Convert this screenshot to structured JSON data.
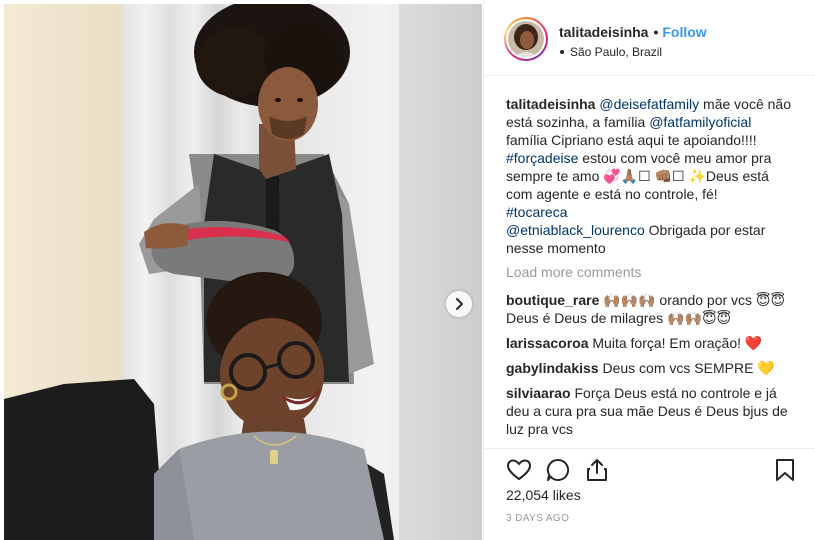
{
  "post": {
    "owner": {
      "username": "talitadeisinha",
      "separator": "•",
      "follow_label": "Follow",
      "location": "São Paulo, Brazil"
    },
    "carousel": {
      "next_icon": "chevron-right-icon"
    },
    "caption": {
      "username": "talitadeisinha",
      "parts": [
        {
          "t": "text",
          "v": " "
        },
        {
          "t": "mention",
          "v": "@deisefatfamily"
        },
        {
          "t": "text",
          "v": " mãe você não está sozinha, a família "
        },
        {
          "t": "mention",
          "v": "@fatfamilyoficial"
        },
        {
          "t": "text",
          "v": " família Cipriano está aqui te apoiando!!!! "
        },
        {
          "t": "br"
        },
        {
          "t": "tag",
          "v": "#forçadeise"
        },
        {
          "t": "text",
          "v": " estou com você meu amor pra sempre te amo 💞🙏🏽☐ 👊🏽☐ ✨Deus está com agente e está no controle, fé! "
        },
        {
          "t": "br"
        },
        {
          "t": "tag",
          "v": "#tocareca"
        },
        {
          "t": "br"
        },
        {
          "t": "mention",
          "v": "@etniablack_lourenco"
        },
        {
          "t": "text",
          "v": " Obrigada por estar nesse momento"
        }
      ]
    },
    "load_more_label": "Load more comments",
    "comments": [
      {
        "username": "boutique_rare",
        "text": "🙌🏽🙌🏽🙌🏽 orando por vcs 😇😇 Deus é Deus de milagres 🙌🏽🙌🏽😇😇"
      },
      {
        "username": "larissacoroa",
        "text": "Muita força! Em oração! ❤️"
      },
      {
        "username": "gabylindakiss",
        "text": "Deus com vcs SEMPRE 💛"
      },
      {
        "username": "silviaarao",
        "text": "Força Deus está no controle e já deu a cura pra sua mãe Deus é Deus bjus de luz pra vcs"
      }
    ],
    "actions": {
      "like_icon": "heart-icon",
      "comment_icon": "comment-icon",
      "share_icon": "share-icon",
      "save_icon": "bookmark-icon"
    },
    "likes_label": "22,054 likes",
    "timestamp": "3 DAYS AGO"
  }
}
